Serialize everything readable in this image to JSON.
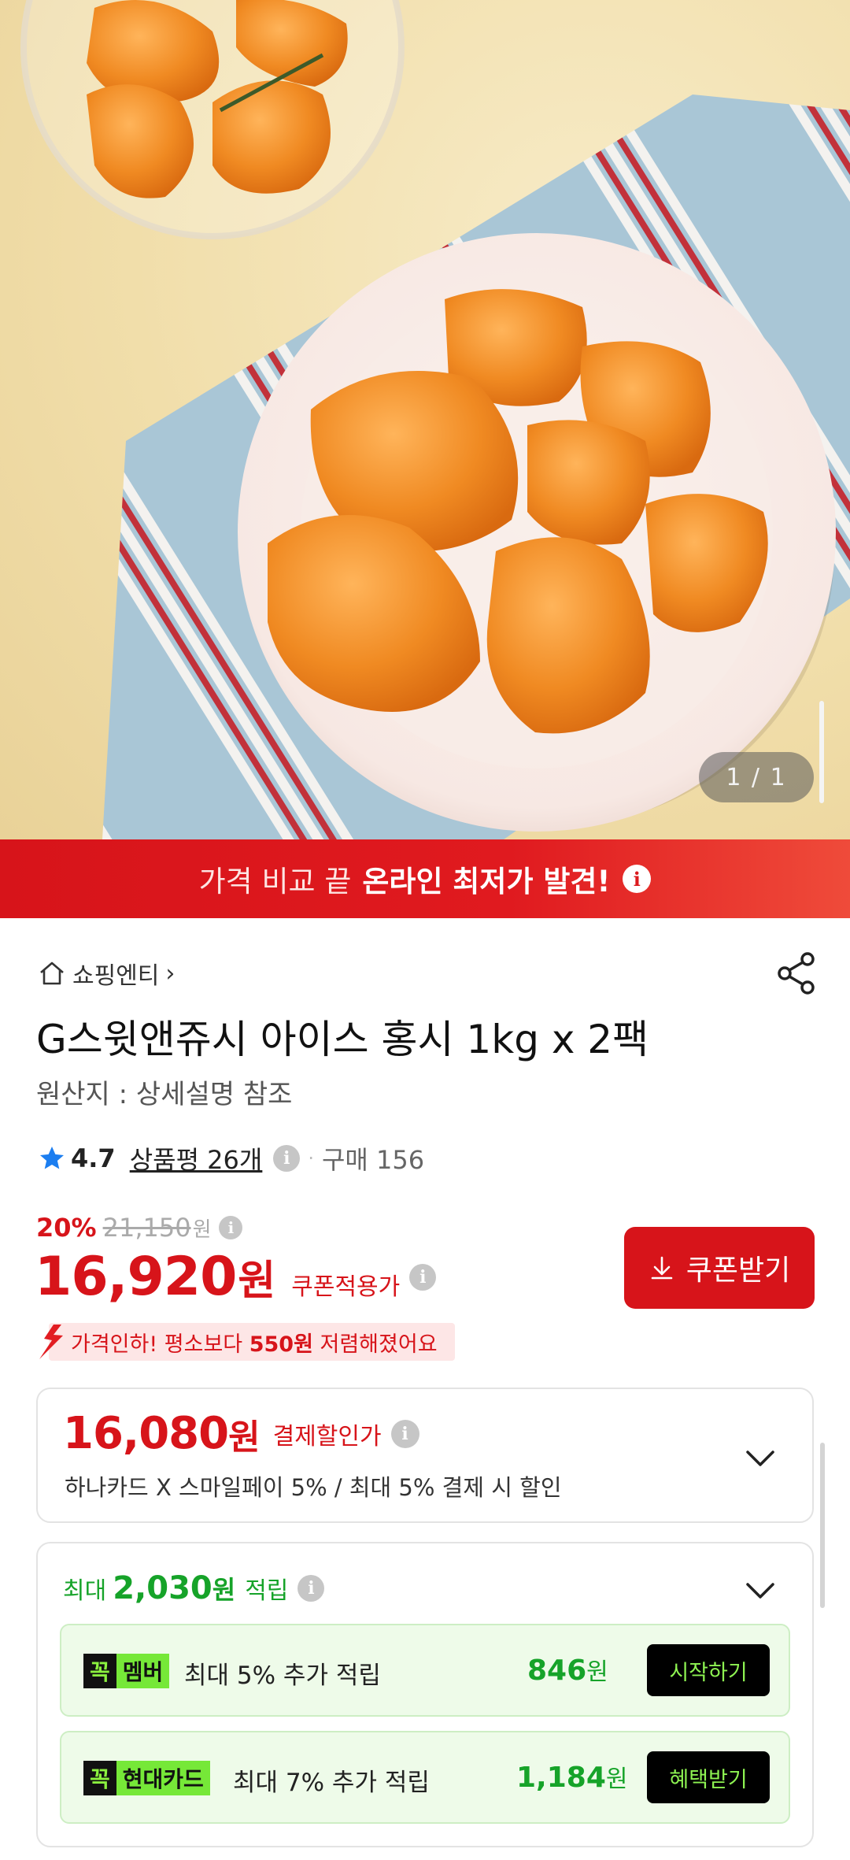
{
  "hero": {
    "image_counter": "1 / 1"
  },
  "promo_banner": {
    "text_normal": "가격 비교 끝",
    "text_bold": "온라인 최저가 발견!",
    "info_icon": "info-icon"
  },
  "product": {
    "breadcrumb": "쇼핑엔티",
    "title": "G스윗앤쥬시 아이스 홍시 1kg x 2팩",
    "origin": "원산지 : 상세설명 참조",
    "rating": "4.7",
    "reviews": "상품평 26개",
    "purchases": "구매 156",
    "discount_rate": "20%",
    "original_price": "21,150",
    "original_price_unit": "원",
    "price": "16,920",
    "price_unit": "원",
    "coupon_price_label": "쿠폰적용가",
    "coupon_button": "쿠폰받기",
    "price_drop_prefix": "가격인하! 평소보다 ",
    "price_drop_amount": "550원",
    "price_drop_suffix": " 저렴해졌어요"
  },
  "payment_discount": {
    "amount": "16,080",
    "unit": "원",
    "label": "결제할인가",
    "detail": "하나카드 X 스마일페이 5% / 최대 5% 결제 시 할인"
  },
  "points": {
    "prefix": "최대",
    "amount": "2,030",
    "unit": "원",
    "label": "적립",
    "benefits": [
      {
        "badge_k": "꼭",
        "badge_name": "멤버",
        "desc": "최대 5% 추가 적립",
        "amount": "846",
        "unit": "원",
        "action": "시작하기"
      },
      {
        "badge_k": "꼭",
        "badge_name": "현대카드",
        "desc": "최대 7% 추가 적립",
        "amount": "1,184",
        "unit": "원",
        "action": "혜택받기"
      }
    ]
  },
  "colors": {
    "accent_red": "#d7141a",
    "points_green": "#16a329",
    "badge_green": "#76e838"
  }
}
